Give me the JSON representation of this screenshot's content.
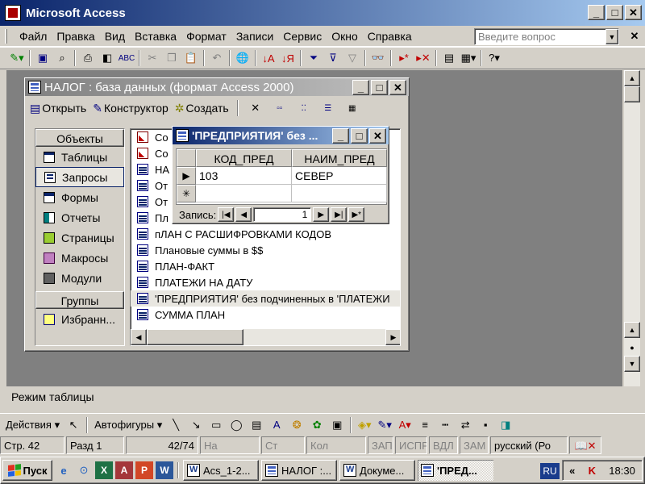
{
  "app": {
    "title": "Microsoft Access"
  },
  "menu": {
    "items": [
      "Файл",
      "Правка",
      "Вид",
      "Вставка",
      "Формат",
      "Записи",
      "Сервис",
      "Окно",
      "Справка"
    ],
    "ask_placeholder": "Введите вопрос"
  },
  "dbwindow": {
    "title": "НАЛОГ : база данных (формат Access 2000)",
    "toolbar": {
      "open": "Открыть",
      "design": "Конструктор",
      "create": "Создать"
    },
    "objects_header": "Объекты",
    "objects": [
      "Таблицы",
      "Запросы",
      "Формы",
      "Отчеты",
      "Страницы",
      "Макросы",
      "Модули"
    ],
    "groups_header": "Группы",
    "groups": [
      "Избранн..."
    ],
    "list": [
      "Со",
      "Со",
      "НА",
      "От",
      "От",
      "Пл",
      "пЛАН С РАСШИФРОВКАМИ КОДОВ",
      "Плановые суммы в $$",
      "ПЛАН-ФАКТ",
      "ПЛАТЕЖИ НА ДАТУ",
      "'ПРЕДПРИЯТИЯ' без подчиненных в 'ПЛАТЕЖИ",
      "СУММА ПЛАН"
    ]
  },
  "table": {
    "title": "'ПРЕДПРИЯТИЯ' без ...",
    "columns": [
      "КОД_ПРЕД",
      "НАИМ_ПРЕД"
    ],
    "rows": [
      [
        "103",
        "СЕВЕР"
      ]
    ],
    "nav_label": "Запись:",
    "record": "1"
  },
  "statusbar": {
    "text": "Режим таблицы"
  },
  "drawing": {
    "actions": "Действия",
    "autoshapes": "Автофигуры"
  },
  "bottom_status": {
    "page": "Стр. 42",
    "section": "Разд 1",
    "pos": "42/74",
    "at": "На",
    "line": "Ст",
    "col": "Кол",
    "rec": "ЗАП",
    "trk": "ИСПР",
    "ext": "ВДЛ",
    "ovr": "ЗАМ",
    "lang": "русский (Ро"
  },
  "taskbar": {
    "start": "Пуск",
    "tasks": [
      "Acs_1-2...",
      "НАЛОГ :...",
      "Докуме...",
      "'ПРЕД..."
    ],
    "lang": "RU",
    "clock": "18:30"
  }
}
